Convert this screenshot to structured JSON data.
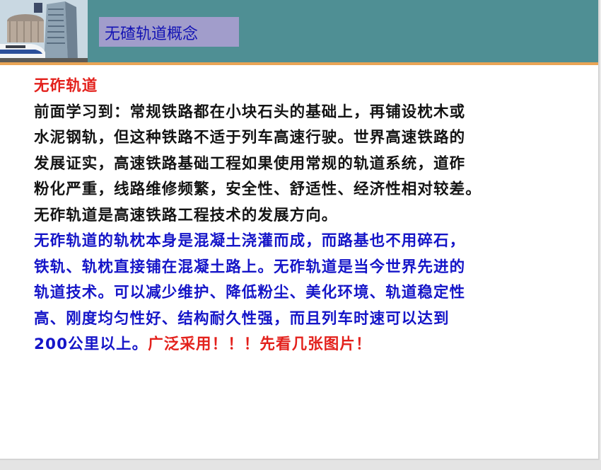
{
  "header": {
    "title": "无碴轨道概念"
  },
  "content": {
    "heading": "无砟轨道",
    "lines_black": [
      "前面学习到：常规铁路都在小块石头的基础上，再铺设枕木或",
      "水泥钢轨，但这种铁路不适于列车高速行驶。世界高速铁路的",
      "发展证实，高速铁路基础工程如果使用常规的轨道系统，道砟",
      "粉化严重，线路维修频繁，安全性、舒适性、经济性相对较差。",
      "无砟轨道是高速铁路工程技术的发展方向。"
    ],
    "lines_blue": [
      "无砟轨道的轨枕本身是混凝土浇灌而成，而路基也不用碎石，",
      "铁轨、轨枕直接铺在混凝土路上。无砟轨道是当今世界先进的",
      "轨道技术。可以减少维护、降低粉尘、美化环境、轨道稳定性",
      "高、刚度均匀性好、结构耐久性强，而且列车时速可以达到"
    ],
    "last_line_blue": "200公里以上。",
    "last_line_red": "广泛采用！！！先看几张图片！"
  },
  "colors": {
    "header_band": "#4f8f94",
    "title_box": "#a19dcb",
    "title_text": "#1414b4",
    "accent_line": "#e9a455",
    "red": "#e3211c",
    "blue": "#1515c8",
    "black": "#141414"
  }
}
